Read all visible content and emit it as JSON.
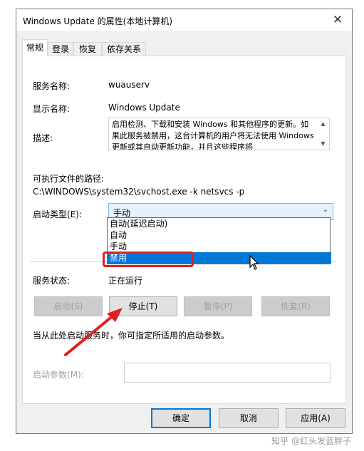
{
  "window": {
    "title": "Windows Update 的属性(本地计算机)",
    "close_label": "✕"
  },
  "tabs": [
    {
      "label": "常规"
    },
    {
      "label": "登录"
    },
    {
      "label": "恢复"
    },
    {
      "label": "依存关系"
    }
  ],
  "general": {
    "service_name_label": "服务名称:",
    "service_name_value": "wuauserv",
    "display_name_label": "显示名称:",
    "display_name_value": "Windows Update",
    "description_label": "描述:",
    "description_text": "启用检测、下载和安装 Windows 和其他程序的更新。如果此服务被禁用，这台计算机的用户将无法使用 Windows 更新或其自动更新功能，并且这些程序将",
    "exe_path_label": "可执行文件的路径:",
    "exe_path_value": "C:\\WINDOWS\\system32\\svchost.exe -k netsvcs -p",
    "startup_type_label": "启动类型(E):",
    "startup_type_value": "手动",
    "startup_options": [
      "自动(延迟启动)",
      "自动",
      "手动",
      "禁用"
    ],
    "service_status_label": "服务状态:",
    "service_status_value": "正在运行",
    "buttons": {
      "start": "启动(S)",
      "stop": "停止(T)",
      "pause": "暂停(P)",
      "resume": "恢复(R)"
    },
    "hint_text": "当从此处启动服务时，你可指定所适用的启动参数。",
    "start_params_label": "启动参数(M):"
  },
  "footer": {
    "ok": "确定",
    "cancel": "取消",
    "apply": "应用(A)"
  },
  "watermark": "知乎 @红头发蓝胖子",
  "colors": {
    "highlight": "#0078d7",
    "annotation_red": "#e02020"
  }
}
